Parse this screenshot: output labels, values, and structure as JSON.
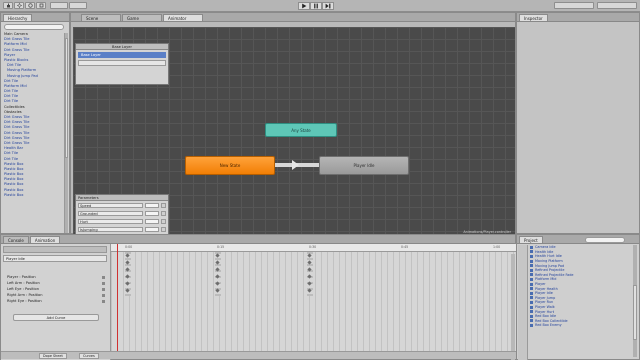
{
  "toolbar": {
    "layers_label": "",
    "layout_label": ""
  },
  "hierarchy": {
    "tab": "Hierarchy",
    "items": [
      {
        "label": "Main Camera",
        "dark": true
      },
      {
        "label": "Dirt Grass Tile",
        "dark": false
      },
      {
        "label": "Platform Mid",
        "dark": false
      },
      {
        "label": "Dirt Grass Tile",
        "dark": false
      },
      {
        "label": "Player",
        "dark": false
      },
      {
        "label": "Plastic Blocks",
        "dark": false
      },
      {
        "label": "Dirt Tile",
        "dark": false
      },
      {
        "label": "Moving Platform",
        "dark": false
      },
      {
        "label": "Moving Jump Pad",
        "dark": false
      },
      {
        "label": "Dirt Tile",
        "dark": false
      },
      {
        "label": "Platform Mid",
        "dark": false
      },
      {
        "label": "Dirt Tile",
        "dark": false
      },
      {
        "label": "Dirt Tile",
        "dark": false
      },
      {
        "label": "Dirt Tile",
        "dark": false
      },
      {
        "label": "Collectibles",
        "dark": true
      },
      {
        "label": "Obstacles",
        "dark": true
      },
      {
        "label": "Dirt Grass Tile",
        "dark": false
      },
      {
        "label": "Dirt Grass Tile",
        "dark": false
      },
      {
        "label": "Dirt Grass Tile",
        "dark": false
      },
      {
        "label": "Dirt Grass Tile",
        "dark": false
      },
      {
        "label": "Dirt Grass Tile",
        "dark": false
      },
      {
        "label": "Dirt Grass Tile",
        "dark": false
      },
      {
        "label": "Health Bar",
        "dark": false
      },
      {
        "label": "Dirt Tile",
        "dark": false
      },
      {
        "label": "Dirt Tile",
        "dark": false
      },
      {
        "label": "Plastic Box",
        "dark": false
      },
      {
        "label": "Plastic Box",
        "dark": false
      },
      {
        "label": "Plastic Box",
        "dark": false
      },
      {
        "label": "Plastic Box",
        "dark": false
      },
      {
        "label": "Plastic Box",
        "dark": false
      },
      {
        "label": "Plastic Box",
        "dark": false
      },
      {
        "label": "Plastic Box",
        "dark": false
      }
    ]
  },
  "animator": {
    "tabs": [
      "Scene",
      "Game",
      "Animator"
    ],
    "layers_header": "Base Layer",
    "layer_name": "Base Layer",
    "params_header": "Parameters",
    "params": [
      {
        "name": "Speed"
      },
      {
        "name": "Grounded"
      },
      {
        "name": "Hurt"
      },
      {
        "name": "IsJumping"
      }
    ],
    "states": {
      "teal": "Any State",
      "orange": "New State",
      "grey": "Player Idle"
    },
    "footer": "Animations/Player.controller"
  },
  "inspector": {
    "tab": "Inspector"
  },
  "animation": {
    "tabs": [
      "Console",
      "Animation"
    ],
    "clip": "Player Idle",
    "properties": [
      "Player : Position",
      "Left Arm : Position",
      "Left Eye : Position",
      "Right Arm : Position",
      "Right Eye : Position"
    ],
    "add_curve": "Add Curve",
    "ruler": [
      "0:00",
      "0:15",
      "0:30",
      "0:45",
      "1:00"
    ],
    "bottom": [
      "Dope Sheet",
      "Curves"
    ]
  },
  "project": {
    "tab": "Project",
    "items": [
      "Camera Idle",
      "Health Idle",
      "Health Hurt Idle",
      "Moving Platform",
      "Moving Jump Pad",
      "Refined Projectile",
      "Refined Projectile Fade",
      "Platform Mid",
      "Player",
      "Player Health",
      "Player Idle",
      "Player Jump",
      "Player Run",
      "Player Walk",
      "Player Hurt",
      "Red Box Idle",
      "Red Box Collectible",
      "Red Box Enemy"
    ]
  }
}
